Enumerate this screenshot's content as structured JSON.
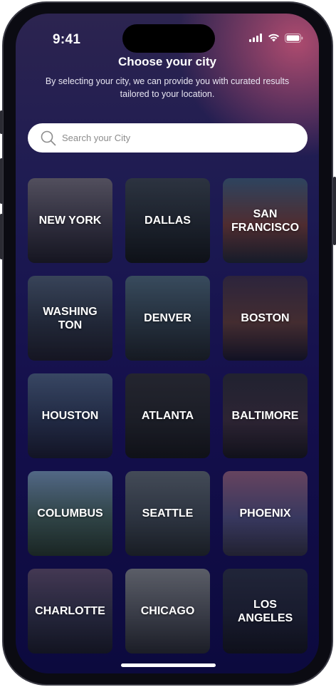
{
  "status_bar": {
    "time": "9:41"
  },
  "header": {
    "title": "Choose your city",
    "subtitle": "By selecting your city, we can provide you with curated results tailored to your location."
  },
  "search": {
    "placeholder": "Search your City",
    "value": ""
  },
  "cities": [
    {
      "label": "NEW YORK",
      "colors": [
        "#6e6a78",
        "#3c3a4a",
        "#1a1a24"
      ]
    },
    {
      "label": "DALLAS",
      "colors": [
        "#3a4450",
        "#222a33",
        "#101418"
      ]
    },
    {
      "label": "SAN\nFRANCISCO",
      "colors": [
        "#3c5a7a",
        "#6a3a3a",
        "#1a2230"
      ]
    },
    {
      "label": "WASHING\nTON",
      "colors": [
        "#4a5a72",
        "#2a3344",
        "#1a1a26"
      ]
    },
    {
      "label": "DENVER",
      "colors": [
        "#4a6478",
        "#2e3d4a",
        "#1a2026"
      ]
    },
    {
      "label": "BOSTON",
      "colors": [
        "#3a2f4a",
        "#5a3a3a",
        "#141428"
      ]
    },
    {
      "label": "HOUSTON",
      "colors": [
        "#4a5e80",
        "#2a3654",
        "#16182a"
      ]
    },
    {
      "label": "ATLANTA",
      "colors": [
        "#2e3038",
        "#22252c",
        "#121418"
      ]
    },
    {
      "label": "BALTIMORE",
      "colors": [
        "#2a2c3a",
        "#3a2e3e",
        "#14141c"
      ]
    },
    {
      "label": "COLUMBUS",
      "colors": [
        "#6e8cb0",
        "#3e5a58",
        "#203028"
      ]
    },
    {
      "label": "SEATTLE",
      "colors": [
        "#5a6470",
        "#3a4450",
        "#1e2428"
      ]
    },
    {
      "label": "PHOENIX",
      "colors": [
        "#8a5a7a",
        "#4a4a7a",
        "#2a2a3a"
      ]
    },
    {
      "label": "CHARLOTTE",
      "colors": [
        "#5a4a6a",
        "#2e3048",
        "#161824"
      ]
    },
    {
      "label": "CHICAGO",
      "colors": [
        "#7a7e86",
        "#4a4e58",
        "#22252c"
      ]
    },
    {
      "label": "LOS\nANGELES",
      "colors": [
        "#2a3046",
        "#1e2236",
        "#10121c"
      ]
    }
  ]
}
